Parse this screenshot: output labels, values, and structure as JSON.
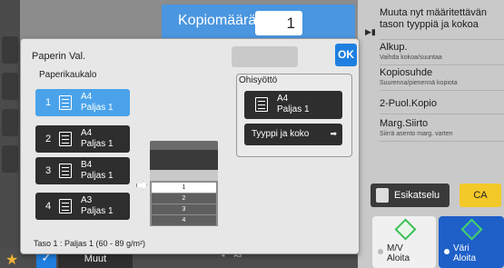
{
  "header": {
    "copies_label": "Kopiomäärä",
    "copies_value": "1"
  },
  "right_panel": {
    "items": [
      {
        "title": "Muuta nyt määritettävän tason tyyppiä ja kokoa",
        "subtitle": ""
      },
      {
        "title": "Alkup.",
        "subtitle": "Vaihda kokoa/suuntaa"
      },
      {
        "title": "Kopiosuhde",
        "subtitle": "Suurenna/pienennä kopiota"
      },
      {
        "title": "2-Puol.Kopio",
        "subtitle": ""
      },
      {
        "title": "Marg.Siirto",
        "subtitle": "Siirrä asento marg. varten"
      }
    ],
    "preview_label": "Esikatselu",
    "ca_label": "CA",
    "bw_start": {
      "line1": "M/V",
      "line2": "Aloita"
    },
    "color_start": {
      "line1": "Väri",
      "line2": "Aloita"
    }
  },
  "bottom_bar": {
    "check_symbol": "✓",
    "more_label": "Muut",
    "mini_row": [
      "4",
      "A3"
    ]
  },
  "dialog": {
    "title": "Paperin Val.",
    "apply_label": "",
    "ok_label": "OK",
    "tray_section_label": "Paperikaukalo",
    "trays": [
      {
        "num": "1",
        "size": "A4",
        "type": "Paljas 1",
        "selected": true
      },
      {
        "num": "2",
        "size": "A4",
        "type": "Paljas 1",
        "selected": false
      },
      {
        "num": "3",
        "size": "B4",
        "type": "Paljas 1",
        "selected": false
      },
      {
        "num": "4",
        "size": "A3",
        "type": "Paljas 1",
        "selected": false
      }
    ],
    "bypass": {
      "label": "Ohisyöttö",
      "size": "A4",
      "type": "Paljas 1",
      "type_size_button": "Tyyppi ja koko"
    },
    "printer_slots": [
      "1",
      "2",
      "3",
      "4"
    ],
    "footer": "Taso 1 : Paljas 1 (60 - 89 g/m²)"
  },
  "colors": {
    "accent_blue": "#1e7fe0",
    "selected_tray": "#4aa3ea",
    "ca_yellow": "#f3c829",
    "start_green": "#3bbf5a"
  }
}
